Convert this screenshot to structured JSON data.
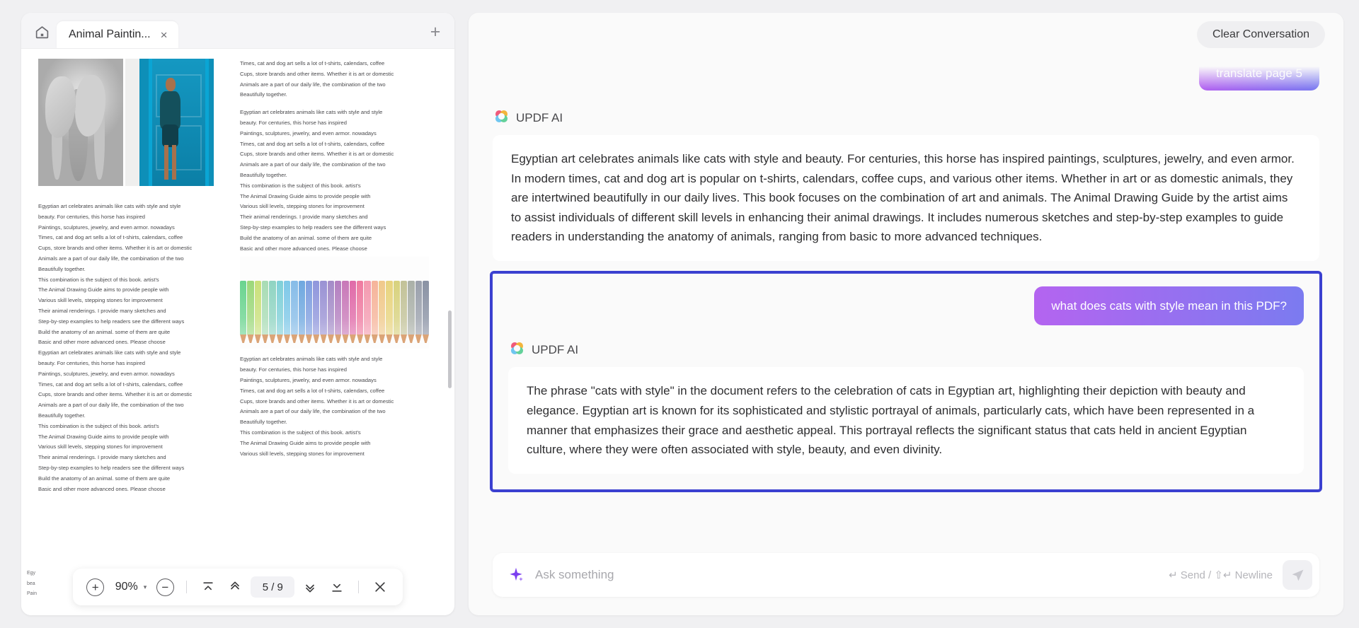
{
  "pdf": {
    "home_icon": "home-icon",
    "tab": {
      "title": "Animal Paintin...",
      "close": "×"
    },
    "new_tab": "+",
    "toolbar": {
      "zoom_in": "+",
      "zoom_level": "90%",
      "caret": "▾",
      "zoom_out": "−",
      "first_page": "first-page-icon",
      "prev_page": "prev-page-icon",
      "page_indicator": "5 / 9",
      "current_page": "5",
      "total_pages": "9",
      "next_page": "next-page-icon",
      "last_page": "last-page-icon",
      "close": "×"
    },
    "edge_text": [
      "Egy",
      "bea",
      "Pain"
    ],
    "page_content": {
      "left_column": [
        "Egyptian art celebrates animals like cats with style and style",
        "beauty. For centuries, this horse has inspired",
        "Paintings, sculptures, jewelry, and even armor. nowadays",
        "Times, cat and dog art sells a lot of t-shirts, calendars, coffee",
        "Cups, store brands and other items. Whether it is art or domestic",
        "Animals are a part of our daily life, the combination of the two",
        "Beautifully together.",
        "This combination is the subject of this book. artist's",
        "The Animal Drawing Guide aims to provide people with",
        "Various skill levels, stepping stones for improvement",
        "Their animal renderings. I provide many sketches and",
        "Step-by-step examples to help readers see the different ways",
        "Build the anatomy of an animal. some of them are quite",
        "Basic and other more advanced ones. Please choose",
        "Egyptian art celebrates animals like cats with style and style",
        "beauty. For centuries, this horse has inspired",
        "Paintings, sculptures, jewelry, and even armor. nowadays",
        "Times, cat and dog art sells a lot of t-shirts, calendars, coffee",
        "Cups, store brands and other items. Whether it is art or domestic",
        "Animals are a part of our daily life, the combination of the two",
        "Beautifully together.",
        "This combination is the subject of this book. artist's",
        "The Animal Drawing Guide aims to provide people with",
        "Various skill levels, stepping stones for improvement",
        "Their animal renderings. I provide many sketches and",
        "Step-by-step examples to help readers see the different ways",
        "Build the anatomy of an animal. some of them are quite",
        "Basic and other more advanced ones. Please choose"
      ],
      "right_column_top": [
        "Times, cat and dog art sells a lot of t-shirts, calendars, coffee",
        "Cups, store brands and other items. Whether it is art or domestic",
        "Animals are a part of our daily life, the combination of the two",
        "Beautifully together."
      ],
      "right_column_mid": [
        "Egyptian art celebrates animals like cats with style and style",
        "beauty. For centuries, this horse has inspired",
        "Paintings, sculptures, jewelry, and even armor. nowadays",
        "Times, cat and dog art sells a lot of t-shirts, calendars, coffee",
        "Cups, store brands and other items. Whether it is art or domestic",
        "Animals are a part of our daily life, the combination of the two",
        "Beautifully together.",
        "This combination is the subject of this book. artist's",
        "The Animal Drawing Guide aims to provide people with",
        "Various skill levels, stepping stones for improvement",
        "Their animal renderings. I provide many sketches and",
        "Step-by-step examples to help readers see the different ways",
        "Build the anatomy of an animal. some of them are quite",
        "Basic and other more advanced ones. Please choose"
      ],
      "right_column_bottom": [
        "Egyptian art celebrates animals like cats with style and style",
        "beauty. For centuries, this horse has inspired",
        "Paintings, sculptures, jewelry, and even armor. nowadays",
        "Times, cat and dog art sells a lot of t-shirts, calendars, coffee",
        "Cups, store brands and other items. Whether it is art or domestic",
        "Animals are a part of our daily life, the combination of the two",
        "Beautifully together.",
        "This combination is the subject of this book. artist's",
        "The Animal Drawing Guide aims to provide people with",
        "Various skill levels, stepping stones for improvement"
      ],
      "images": [
        "elephant-pencil-drawing",
        "man-by-blue-door-photo",
        "colored-pencils-photo"
      ]
    }
  },
  "ai": {
    "clear_button": "Clear Conversation",
    "translate_chip": "translate page 5",
    "assistant_name": "UPDF AI",
    "logo_icon": "updf-ai-clover-icon",
    "messages": [
      {
        "role": "assistant",
        "text": "Egyptian art celebrates animals like cats with style and beauty. For centuries, this horse has inspired paintings, sculptures, jewelry, and even armor. In modern times, cat and dog art is popular on t-shirts, calendars, coffee cups, and various other items. Whether in art or as domestic animals, they are intertwined beautifully in our daily lives. This book focuses on the combination of art and animals. The Animal Drawing Guide by the artist aims to assist individuals of different skill levels in enhancing their animal drawings. It includes numerous sketches and step-by-step examples to guide readers in understanding the anatomy of animals, ranging from basic to more advanced techniques."
      },
      {
        "role": "user",
        "text": "what does cats with style mean in this PDF?"
      },
      {
        "role": "assistant",
        "text": "The phrase \"cats with style\" in the document refers to the celebration of cats in Egyptian art, highlighting their depiction with beauty and elegance. Egyptian art is known for its sophisticated and stylistic portrayal of animals, particularly cats, which have been represented in a manner that emphasizes their grace and aesthetic appeal. This portrayal reflects the significant status that cats held in ancient Egyptian culture, where they were often associated with style, beauty, and even divinity."
      }
    ],
    "input": {
      "placeholder": "Ask something",
      "value": "",
      "hint": "↵ Send  /  ⇧↵ Newline",
      "send_icon": "send-paper-plane-icon",
      "sparkle_icon": "sparkle-icon"
    }
  },
  "colors": {
    "highlight_border": "#3b40d0",
    "user_bubble_start": "#b464f0",
    "user_bubble_end": "#7b7bf0",
    "app_background": "#f0f0f2"
  }
}
